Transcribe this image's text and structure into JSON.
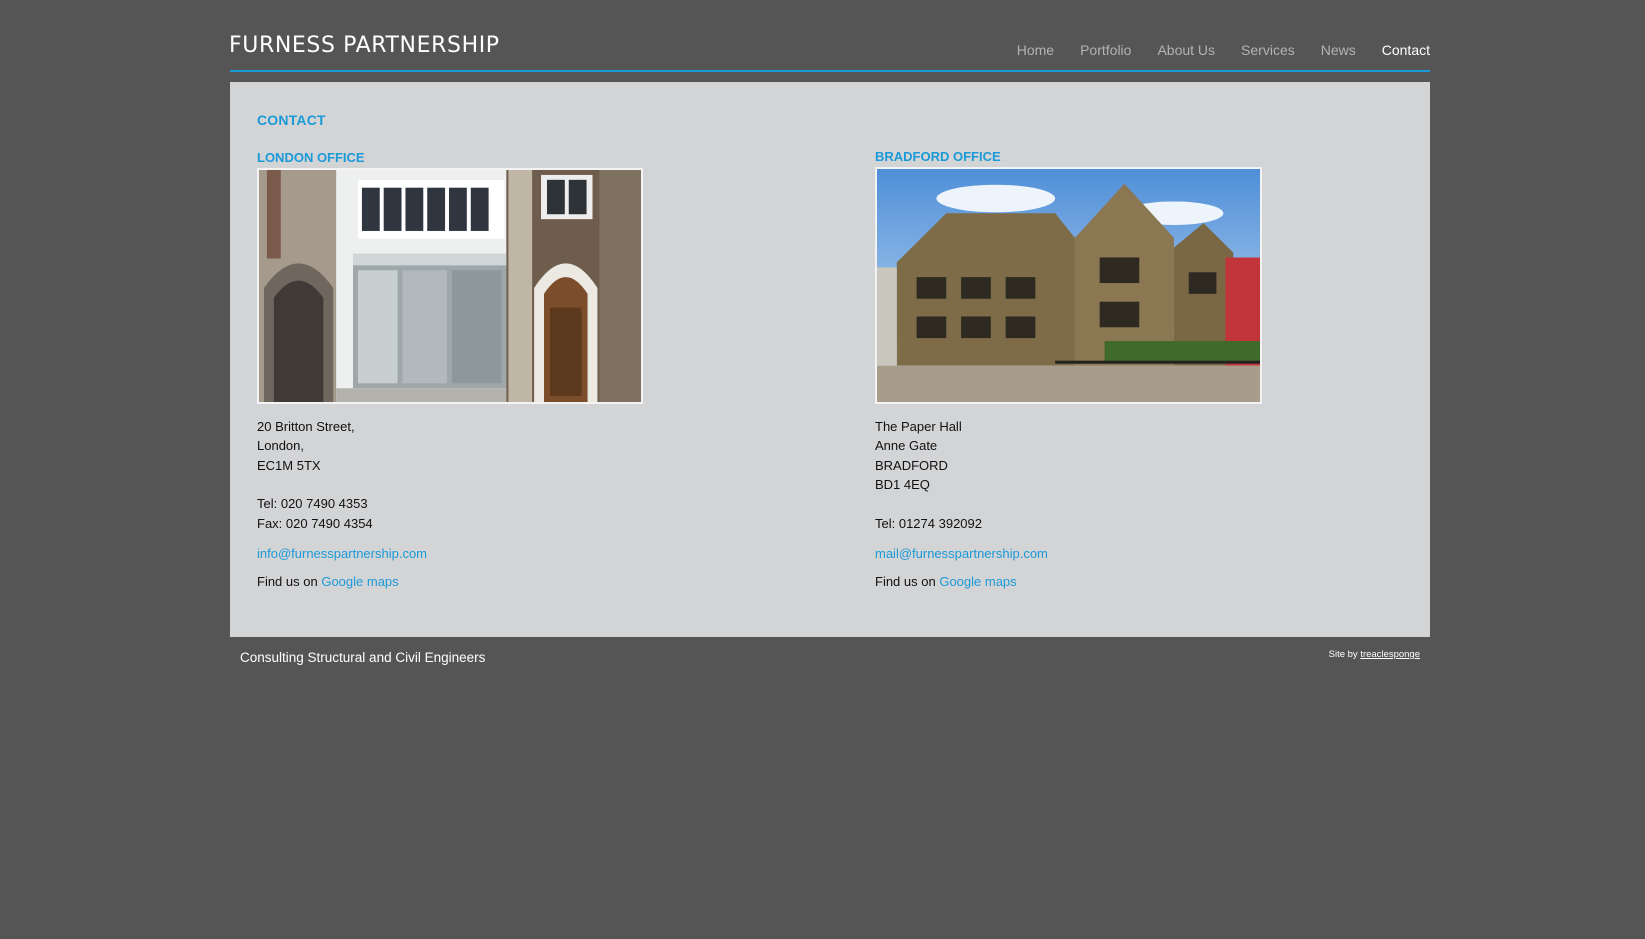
{
  "header": {
    "logo": "FURNESS PARTNERSHIP",
    "nav": [
      {
        "label": "Home"
      },
      {
        "label": "Portfolio"
      },
      {
        "label": "About Us"
      },
      {
        "label": "Services"
      },
      {
        "label": "News"
      },
      {
        "label": "Contact"
      }
    ],
    "active_nav": "Contact"
  },
  "page": {
    "heading": "CONTACT"
  },
  "london": {
    "title": "LONDON OFFICE",
    "address_lines": [
      "20 Britton Street,",
      "London,",
      "EC1M 5TX"
    ],
    "tel": "Tel: 020 7490 4353",
    "fax": "Fax: 020 7490 4354",
    "email": "info@furnesspartnership.com",
    "find_prefix": "Find us on",
    "find_link": "Google maps"
  },
  "bradford": {
    "title": "BRADFORD OFFICE",
    "address_lines": [
      "The Paper Hall",
      "Anne Gate",
      "BRADFORD",
      "BD1 4EQ"
    ],
    "tel": "Tel: 01274 392092",
    "email": "mail@furnesspartnership.com",
    "find_prefix": "Find us on",
    "find_link": "Google maps"
  },
  "footer": {
    "tagline": "Consulting Structural and Civil Engineers",
    "credit_prefix": "Site by",
    "credit_link": "treaclesponge"
  },
  "colors": {
    "background": "#555555",
    "panel": "#d3d4d6",
    "accent": "#1b9ad8",
    "nav_inactive": "#b3b3b3",
    "nav_active": "#ffffff"
  }
}
